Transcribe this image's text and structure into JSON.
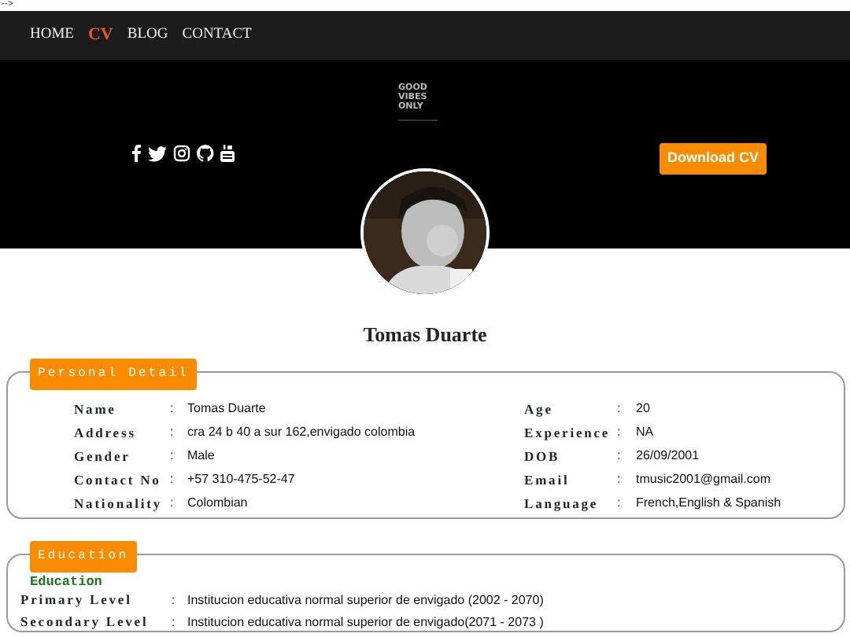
{
  "stray_text": "-->",
  "nav": [
    {
      "label": "HOME",
      "selected": false
    },
    {
      "label": "CV",
      "selected": true
    },
    {
      "label": "BLOG",
      "selected": false
    },
    {
      "label": "CONTACT",
      "selected": false
    }
  ],
  "banner": {
    "logo_lines": [
      "GOOD",
      "VIBES",
      "ONLY"
    ],
    "social": [
      {
        "kind": "facebook"
      },
      {
        "kind": "twitter"
      },
      {
        "kind": "instagram"
      },
      {
        "kind": "github"
      },
      {
        "kind": "youtube"
      }
    ],
    "button": "Download CV",
    "photo": {
      "kind": "picture"
    }
  },
  "name": "Tomas Duarte",
  "personal": {
    "legend": "Personal Detail",
    "left": [
      {
        "label": "Name",
        "separator": ":",
        "value": "Tomas Duarte"
      },
      {
        "label": "Address",
        "separator": ":",
        "value": "cra 24 b 40 a sur 162,envigado colombia"
      },
      {
        "label": "Gender",
        "separator": ":",
        "value": "Male"
      },
      {
        "label": "Contact No",
        "separator": ":",
        "value": "+57 310-475-52-47"
      },
      {
        "label": "Nationality",
        "separator": ":",
        "value": "Colombian"
      }
    ],
    "right": [
      {
        "label": "Age",
        "separator": ":",
        "value": "20"
      },
      {
        "label": "Experience",
        "separator": ":",
        "value": "NA"
      },
      {
        "label": "DOB",
        "separator": ":",
        "value": "26/09/2001"
      },
      {
        "label": "Email",
        "separator": ":",
        "value": "tmusic2001@gmail.com"
      },
      {
        "label": "Language",
        "separator": ":",
        "value": "French,English & Spanish"
      }
    ]
  },
  "education": {
    "legend": "Education",
    "heading": "Education",
    "rows": [
      {
        "label": "Primary Level",
        "separator": ":",
        "value": "Institucion educativa normal superior de envigado (2002 - 2070)"
      },
      {
        "label": "Secondary Level",
        "separator": ":",
        "value": "Institucion educativa normal superior de envigado(2071 - 2073 )"
      }
    ]
  }
}
